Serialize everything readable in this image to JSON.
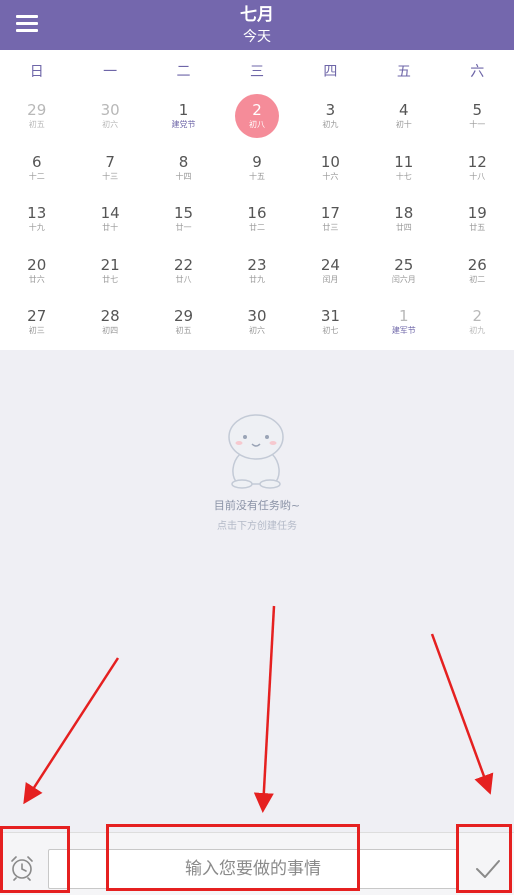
{
  "header": {
    "month": "七月",
    "today": "今天"
  },
  "weekdays": [
    "日",
    "一",
    "二",
    "三",
    "四",
    "五",
    "六"
  ],
  "weeks": [
    [
      {
        "num": "29",
        "lunar": "初五"
      },
      {
        "num": "30",
        "lunar": "初六"
      },
      {
        "num": "1",
        "lunar": "建党节"
      },
      {
        "num": "2",
        "lunar": "初八"
      },
      {
        "num": "3",
        "lunar": "初九"
      },
      {
        "num": "4",
        "lunar": "初十"
      },
      {
        "num": "5",
        "lunar": "十一"
      }
    ],
    [
      {
        "num": "6",
        "lunar": "十二"
      },
      {
        "num": "7",
        "lunar": "十三"
      },
      {
        "num": "8",
        "lunar": "十四"
      },
      {
        "num": "9",
        "lunar": "十五"
      },
      {
        "num": "10",
        "lunar": "十六"
      },
      {
        "num": "11",
        "lunar": "十七"
      },
      {
        "num": "12",
        "lunar": "十八"
      }
    ],
    [
      {
        "num": "13",
        "lunar": "十九"
      },
      {
        "num": "14",
        "lunar": "廿十"
      },
      {
        "num": "15",
        "lunar": "廿一"
      },
      {
        "num": "16",
        "lunar": "廿二"
      },
      {
        "num": "17",
        "lunar": "廿三"
      },
      {
        "num": "18",
        "lunar": "廿四"
      },
      {
        "num": "19",
        "lunar": "廿五"
      }
    ],
    [
      {
        "num": "20",
        "lunar": "廿六"
      },
      {
        "num": "21",
        "lunar": "廿七"
      },
      {
        "num": "22",
        "lunar": "廿八"
      },
      {
        "num": "23",
        "lunar": "廿九"
      },
      {
        "num": "24",
        "lunar": "闰月"
      },
      {
        "num": "25",
        "lunar": "闰六月"
      },
      {
        "num": "26",
        "lunar": "初二"
      }
    ],
    [
      {
        "num": "27",
        "lunar": "初三"
      },
      {
        "num": "28",
        "lunar": "初四"
      },
      {
        "num": "29",
        "lunar": "初五"
      },
      {
        "num": "30",
        "lunar": "初六"
      },
      {
        "num": "31",
        "lunar": "初七"
      },
      {
        "num": "1",
        "lunar": "建军节"
      },
      {
        "num": "2",
        "lunar": "初九"
      }
    ]
  ],
  "empty_state": {
    "title": "目前没有任务哟~",
    "hint": "点击下方创建任务"
  },
  "task_input": {
    "placeholder": "输入您要做的事情",
    "value": ""
  },
  "colors": {
    "header": "#7467ad",
    "selected": "#f58c99",
    "annotation": "#e52020"
  },
  "icons": {
    "menu": "menu-icon",
    "alarm": "alarm-clock-icon",
    "confirm": "checkmark-icon"
  }
}
